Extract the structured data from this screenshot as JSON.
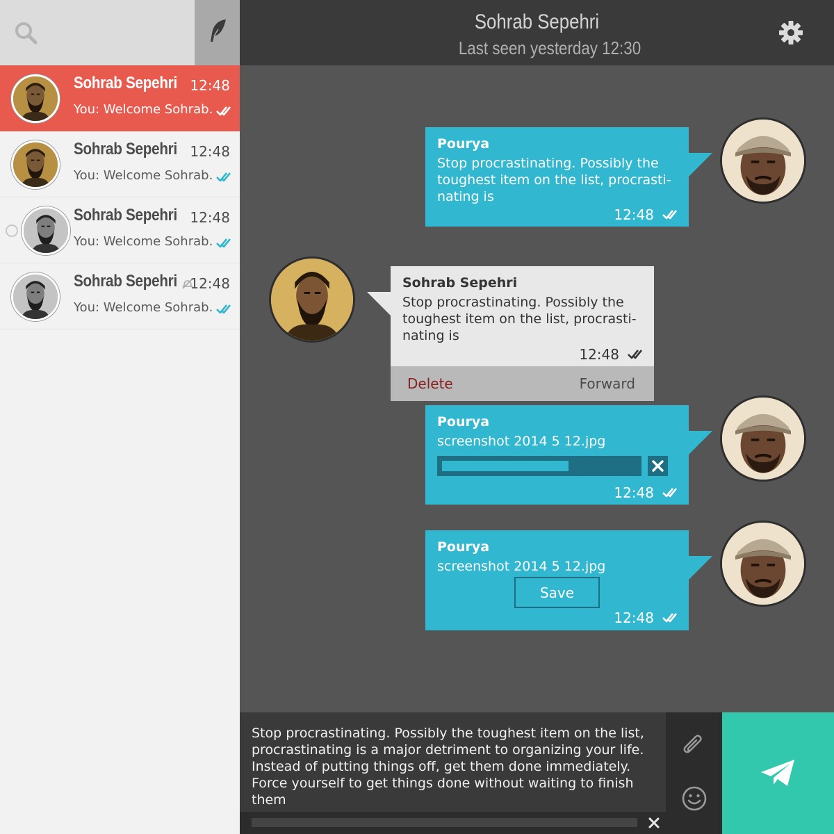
{
  "sidebar": {
    "chats": [
      {
        "name": "Sohrab Sepehri",
        "time": "12:48",
        "preview": "You: Welcome Sohrab...",
        "active": true,
        "avatar": "sepia"
      },
      {
        "name": "Sohrab Sepehri",
        "time": "12:48",
        "preview": "You: Welcome Sohrab...",
        "active": false,
        "avatar": "sepia"
      },
      {
        "name": "Sohrab Sepehri",
        "time": "12:48",
        "preview": "You: Welcome Sohrab...",
        "active": false,
        "avatar": "gray",
        "selectable": true
      },
      {
        "name": "Sohrab Sepehri",
        "time": "12:48",
        "preview": "You: Welcome Sohrab...",
        "active": false,
        "avatar": "gray",
        "muted": true
      }
    ]
  },
  "header": {
    "title": "Sohrab Sepehri",
    "subtitle": "Last seen yesterday 12:30"
  },
  "messages": [
    {
      "sender": "Pourya",
      "text": "Stop procrastinating. Possibly the toughest item on the list, procrasti- nating is",
      "time": "12:48"
    },
    {
      "sender": "Sohrab Sepehri",
      "text": "Stop procrastinating. Possibly the toughest item on the list, procrasti- nating is",
      "time": "12:48",
      "actions": {
        "delete": "Delete",
        "forward": "Forward"
      }
    },
    {
      "sender": "Pourya",
      "file": "screenshot 2014 5 12.jpg",
      "time": "12:48",
      "progress": 0.65
    },
    {
      "sender": "Pourya",
      "file": "screenshot 2014 5 12.jpg",
      "time": "12:48",
      "save_label": "Save"
    }
  ],
  "composer": {
    "text": "Stop procrastinating. Possibly the toughest item on the list, procrastinating is a major detriment to organizing your life. Instead of putting things off, get them done immediately. Force yourself to get things done without waiting to finish them"
  },
  "icons": {
    "search": "search-icon",
    "compose": "feather-icon",
    "settings": "gear-icon",
    "read": "double-check-icon",
    "mute": "mute-icon",
    "attach": "paperclip-icon",
    "emoji": "smiley-icon",
    "send": "paper-plane-icon",
    "cancel": "close-icon"
  },
  "colors": {
    "active_chat": "#e85a4e",
    "outgoing_bubble": "#31b7cf",
    "incoming_bubble": "#e8e8e8",
    "send_button": "#32c8ad",
    "header": "#3a3a3a",
    "chat_background": "#555555",
    "delete_text": "#8a1f1f"
  }
}
